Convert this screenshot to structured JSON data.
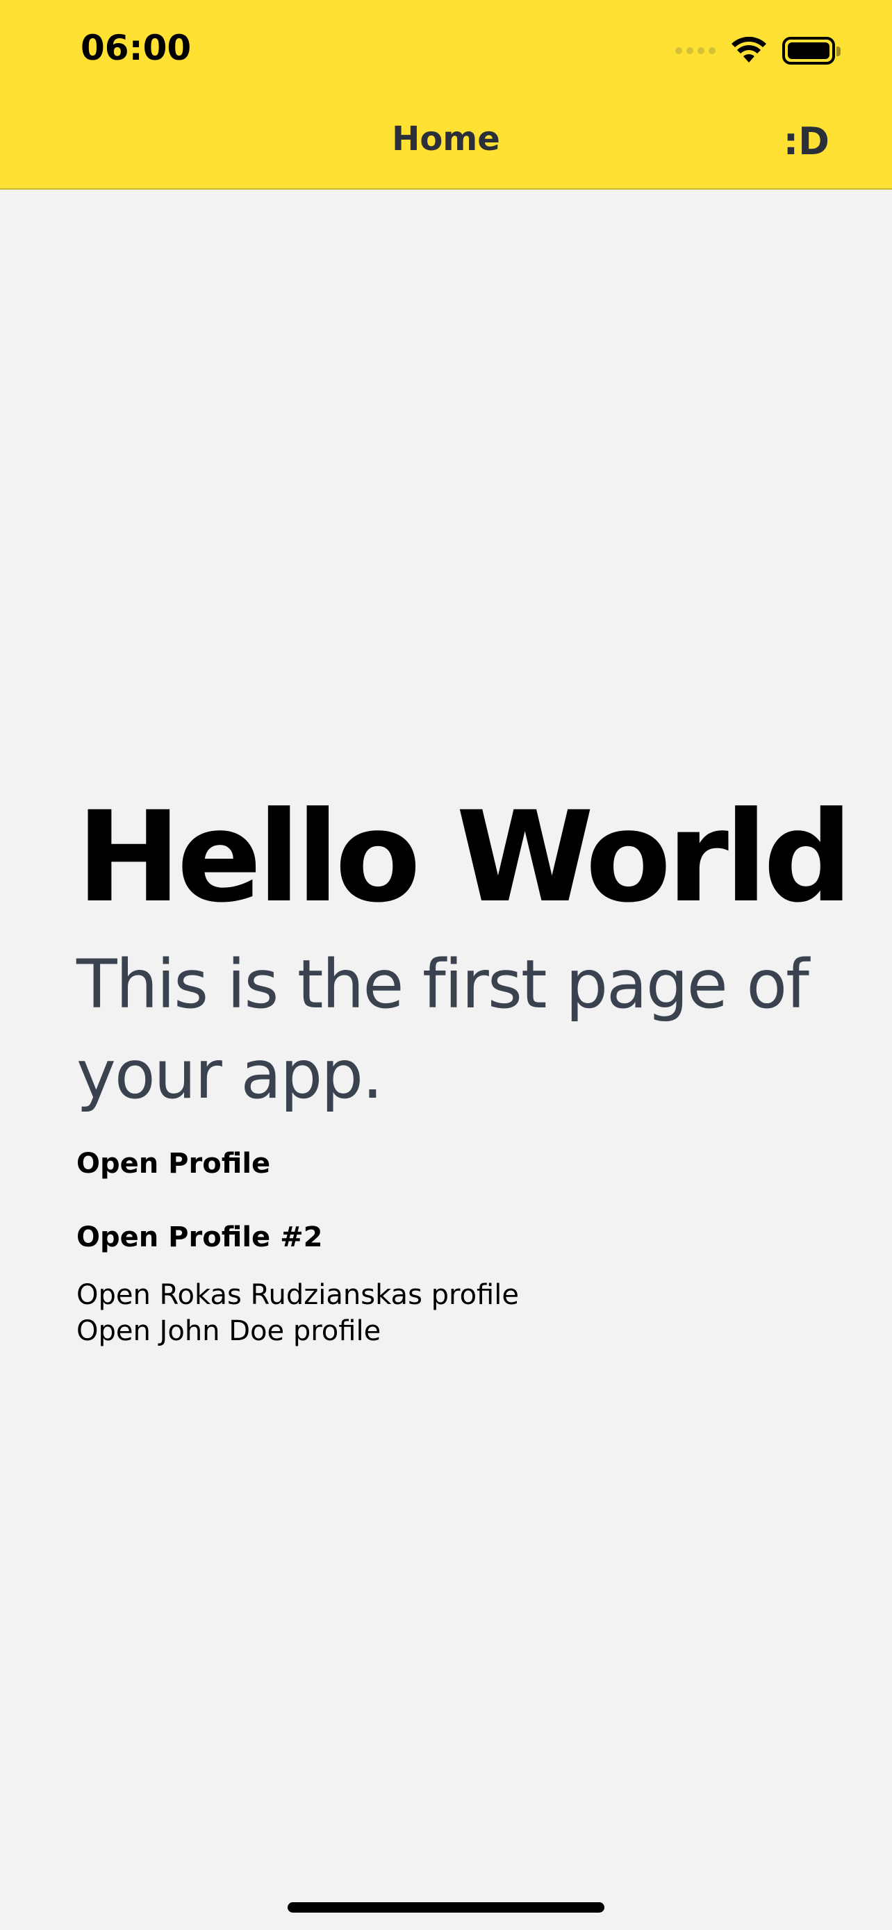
{
  "status_bar": {
    "time": "06:00",
    "icons": [
      "cellular-signal-icon",
      "wifi-icon",
      "battery-icon"
    ]
  },
  "nav_bar": {
    "title": "Home",
    "action_label": ":D",
    "background_color": "#ffe134"
  },
  "main": {
    "title": "Hello World",
    "subtitle": "This is the first page of your app.",
    "links": {
      "open_profile": "Open Profile",
      "open_profile_2": "Open Profile #2",
      "open_rokas_profile": "Open Rokas Rudzianskas profile",
      "open_john_profile": "Open John Doe profile"
    }
  }
}
